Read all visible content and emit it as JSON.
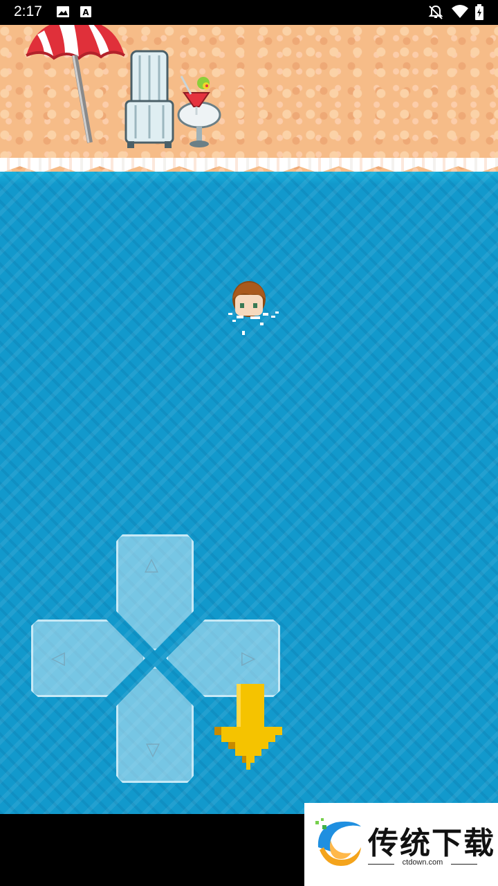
{
  "status_bar": {
    "time": "2:17",
    "icons": [
      "image-icon",
      "font-a-icon",
      "notifications-off-icon",
      "wifi-icon",
      "battery-icon"
    ]
  },
  "scene": {
    "beach_props": [
      "beach-umbrella-icon",
      "deck-chair-icon",
      "cocktail-table-icon"
    ],
    "player": "swimming-character-icon",
    "hint_arrow": "down-arrow-icon"
  },
  "dpad": {
    "up_glyph": "△",
    "down_glyph": "▽",
    "left_glyph": "◁",
    "right_glyph": "▷"
  },
  "watermark": {
    "title": "传统下载",
    "subtitle": "ctdown.com"
  },
  "colors": {
    "sea": "#1299cc",
    "sand": "#f6bc88",
    "arrow": "#f5c300",
    "umbrella_red": "#e0303a"
  }
}
